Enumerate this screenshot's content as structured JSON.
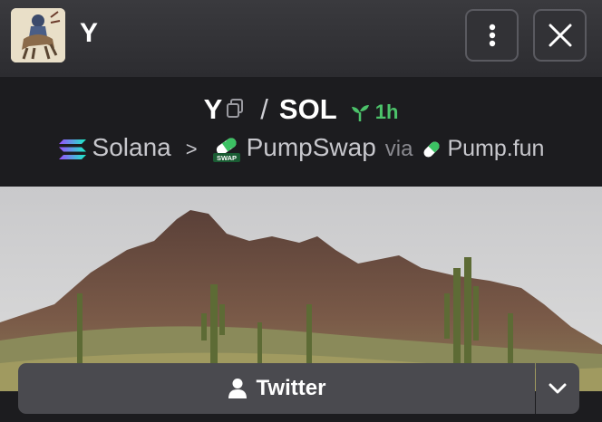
{
  "header": {
    "title": "Y",
    "avatar_icon": "cowboy-rider-icon",
    "more_icon": "more-vertical-icon",
    "close_icon": "close-icon"
  },
  "pair": {
    "base": "Y",
    "quote": "SOL",
    "separator": "/",
    "age": "1h",
    "age_color": "#4cc26a"
  },
  "breadcrumb": {
    "chain": "Solana",
    "dex": "PumpSwap",
    "via": "via",
    "launchpad": "Pump.fun"
  },
  "actions": {
    "twitter_label": "Twitter"
  }
}
